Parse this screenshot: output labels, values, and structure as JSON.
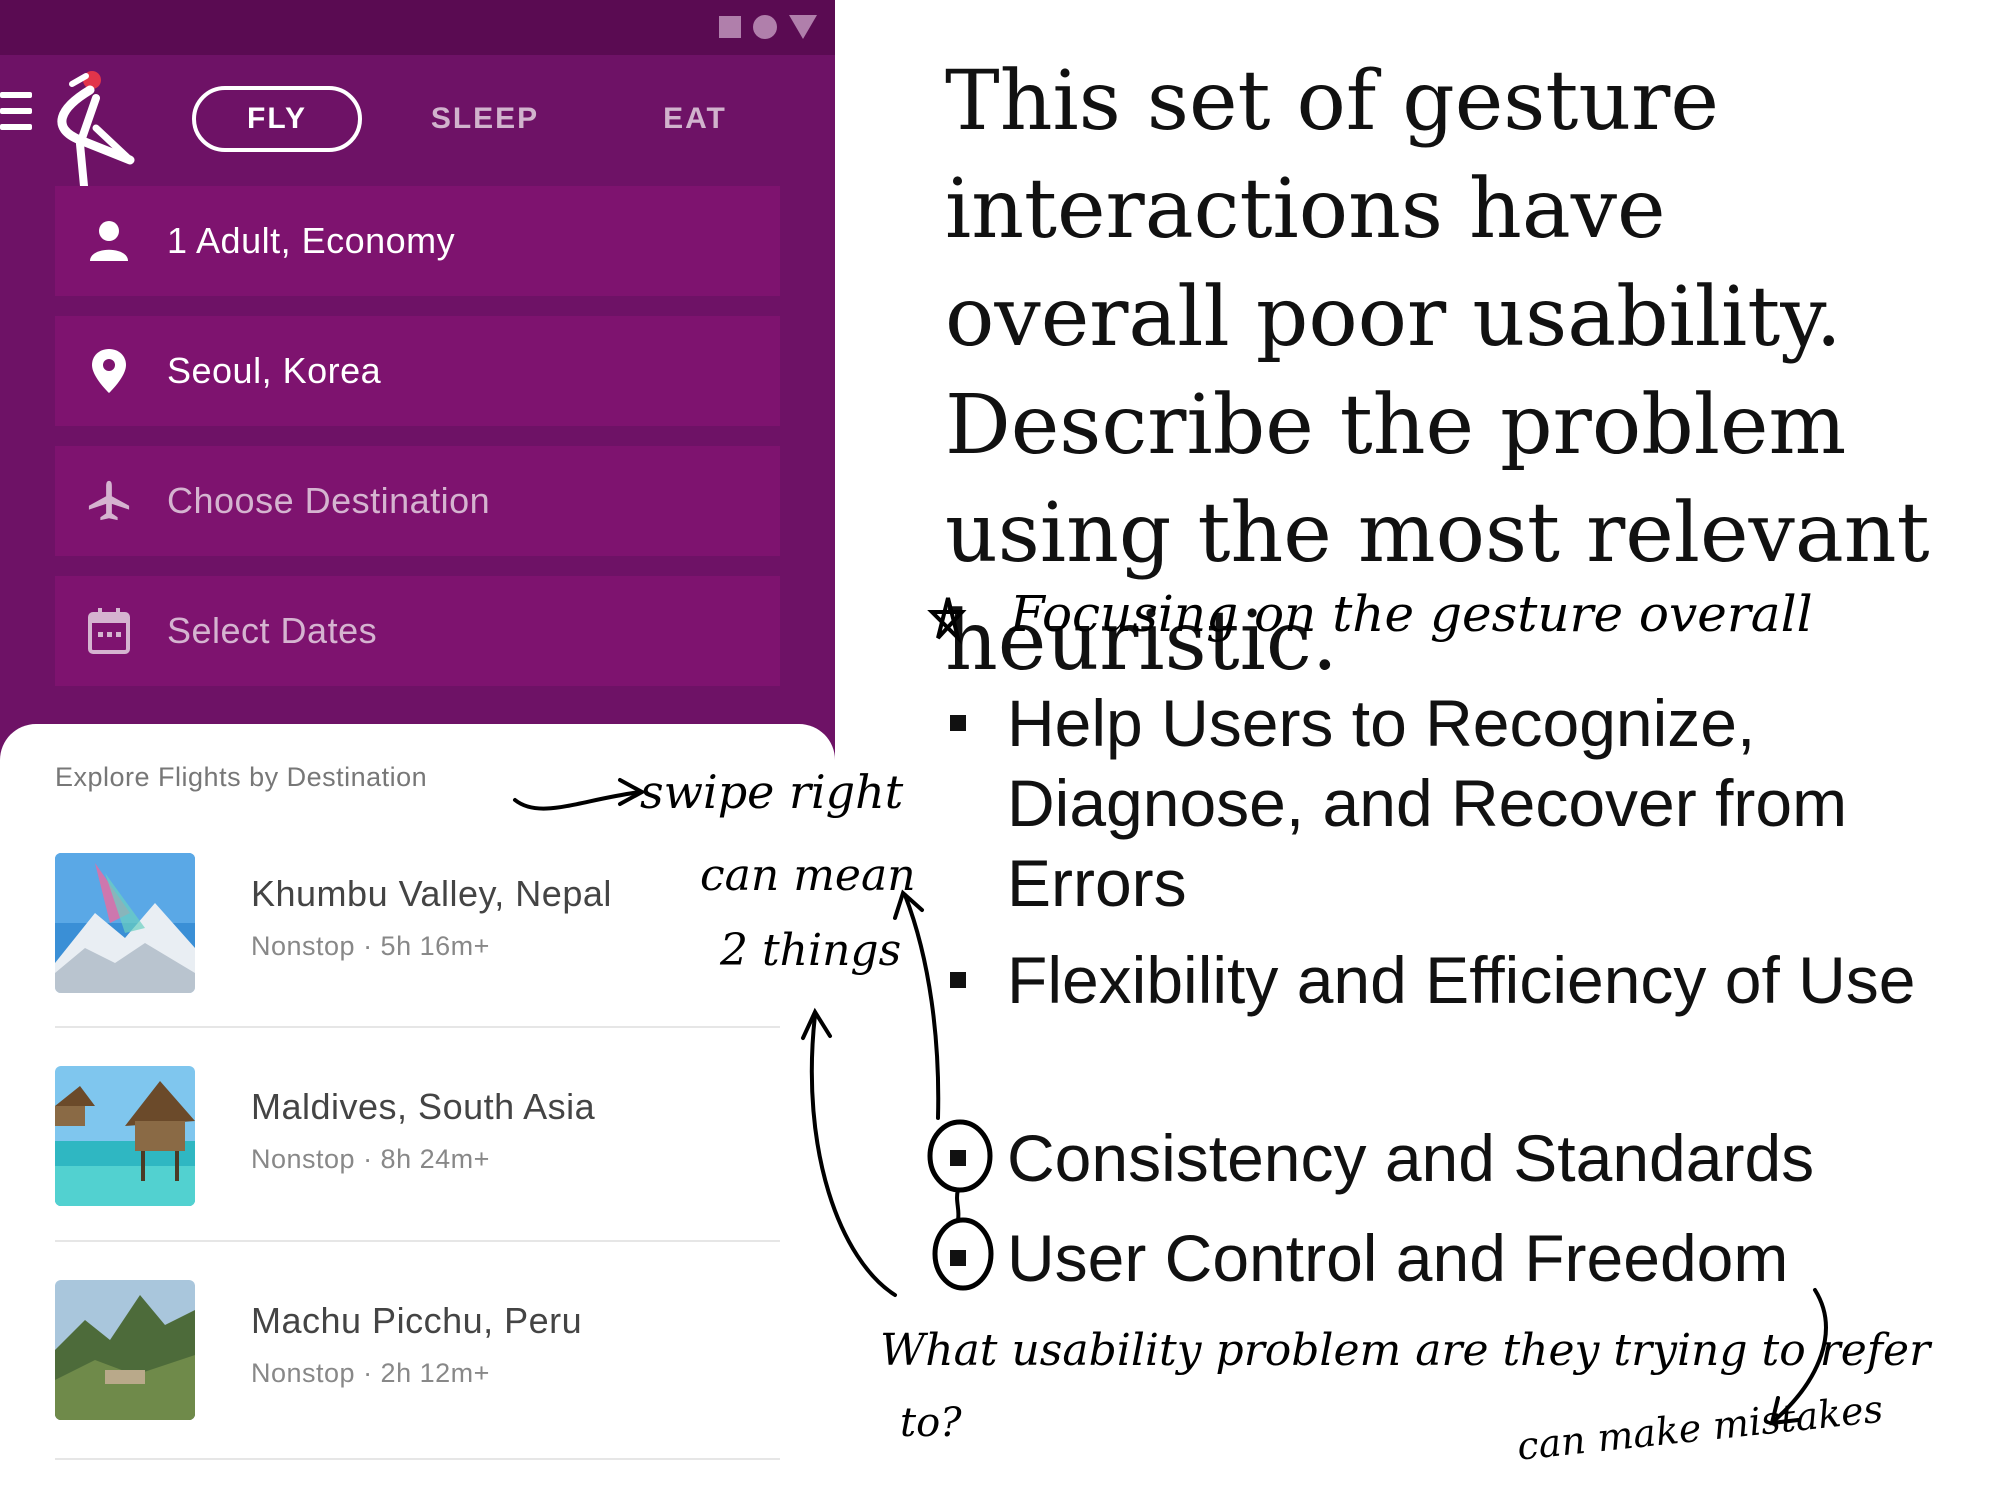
{
  "app": {
    "tabs": [
      {
        "label": "FLY",
        "active": true
      },
      {
        "label": "SLEEP",
        "active": false
      },
      {
        "label": "EAT",
        "active": false
      }
    ],
    "fields": {
      "passengers": {
        "label": "1 Adult, Economy",
        "icon": "person-icon"
      },
      "origin": {
        "label": "Seoul, Korea",
        "icon": "location-pin-icon"
      },
      "destination": {
        "label": "Choose Destination",
        "icon": "airplane-icon"
      },
      "dates": {
        "label": "Select Dates",
        "icon": "calendar-icon"
      }
    },
    "explore": {
      "title": "Explore Flights by Destination",
      "destinations": [
        {
          "name": "Khumbu Valley, Nepal",
          "detail": "Nonstop · 5h 16m+"
        },
        {
          "name": "Maldives, South Asia",
          "detail": "Nonstop · 8h 24m+"
        },
        {
          "name": "Machu Picchu, Peru",
          "detail": "Nonstop · 2h 12m+"
        }
      ]
    },
    "colors": {
      "primary": "#6e1266",
      "field": "#7e136f",
      "statusbar": "#5a0b52"
    }
  },
  "slide": {
    "question": "This set of gesture interactions have overall poor usability. Describe the problem using the most relevant heuristic.",
    "options": [
      "Help Users to Recognize, Diagnose, and Recover from Errors",
      "Flexibility and Efficiency of Use",
      "Consistency and Standards",
      "User Control and Freedom"
    ]
  },
  "annotations": {
    "focus_note": "Focusing on the gesture overall",
    "swipe": "swipe right",
    "can_mean": "can mean",
    "two_things": "2 things",
    "question_line1": "What usability problem are they trying to refer",
    "question_line2": "to?",
    "mistakes": "can make mistakes"
  }
}
